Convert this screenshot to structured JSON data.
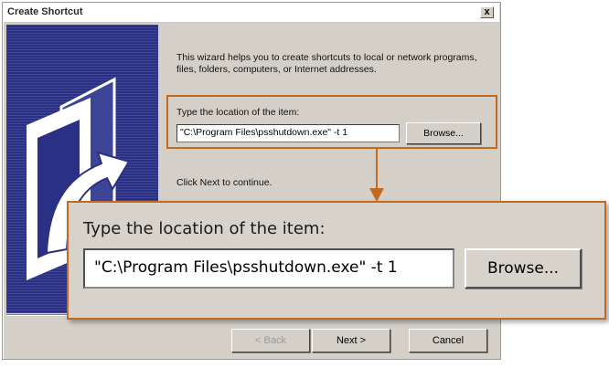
{
  "window": {
    "title": "Create Shortcut",
    "close_label": "x"
  },
  "intro": {
    "text": "This wizard helps you to create shortcuts to local or network programs, files, folders, computers, or Internet addresses."
  },
  "location": {
    "label": "Type the location of the item:",
    "value": "\"C:\\Program Files\\psshutdown.exe\" -t 1",
    "browse_label": "Browse..."
  },
  "continue_text": "Click Next to continue.",
  "zoom": {
    "label": "Type the location of the item:",
    "value": "\"C:\\Program Files\\psshutdown.exe\" -t 1",
    "browse_label": "Browse..."
  },
  "buttons": {
    "back": "< Back",
    "next": "Next >",
    "cancel": "Cancel"
  },
  "icons": {
    "side_art": "shortcut-arrow-icon",
    "callout_arrow": "down-arrow-icon"
  },
  "colors": {
    "side_panel": "#2a3185",
    "highlight": "#c26a22",
    "dialog_face": "#d4d0c8"
  }
}
